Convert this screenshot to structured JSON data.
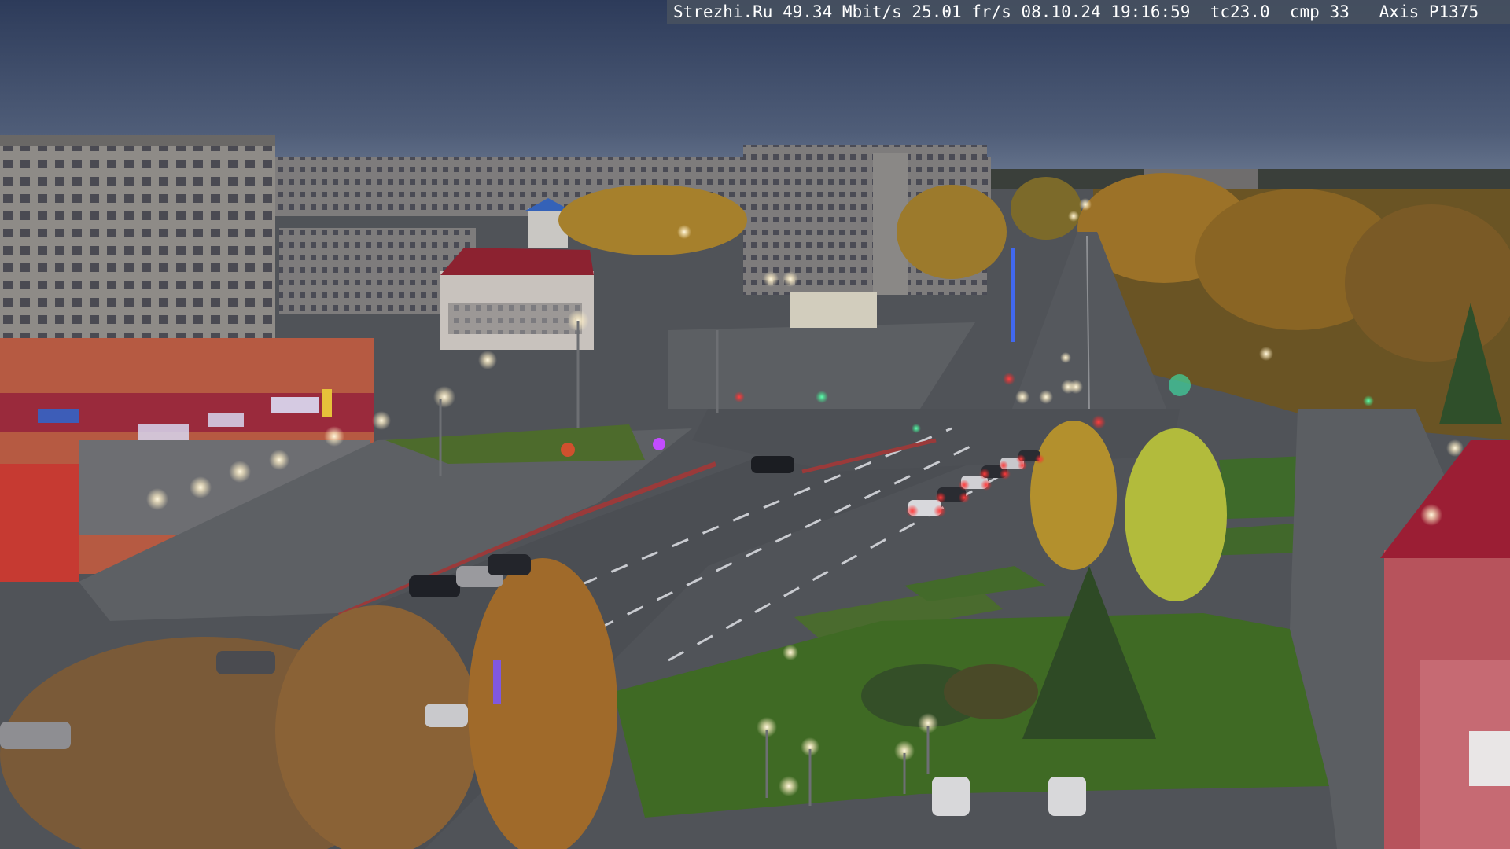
{
  "overlay": {
    "caption": "Strezhi.Ru 49.34 Mbit/s 25.01 fr/s 08.10.24 19:16:59  tc23.0  cmp 33   Axis P1375"
  },
  "scene": {
    "description_colors": {
      "sky_top": "#2f3f5f",
      "sky_horizon": "#6b7a93",
      "building_panel": "#8d8a86",
      "building_dark": "#5e5c5c",
      "roof_red": "#8c2230",
      "shop_facade": "#b4543e",
      "asphalt": "#4e5156",
      "plaza": "#5e6064",
      "grass": "#3f6b2a",
      "tree_autumn": "#a0752a",
      "tree_yellow": "#c39a36",
      "street_light": "#fff4d8",
      "tail_light": "#ff3333",
      "neon_blue": "#4a8bff",
      "neon_purple": "#c040ff",
      "signal_green": "#35ff9a"
    }
  }
}
